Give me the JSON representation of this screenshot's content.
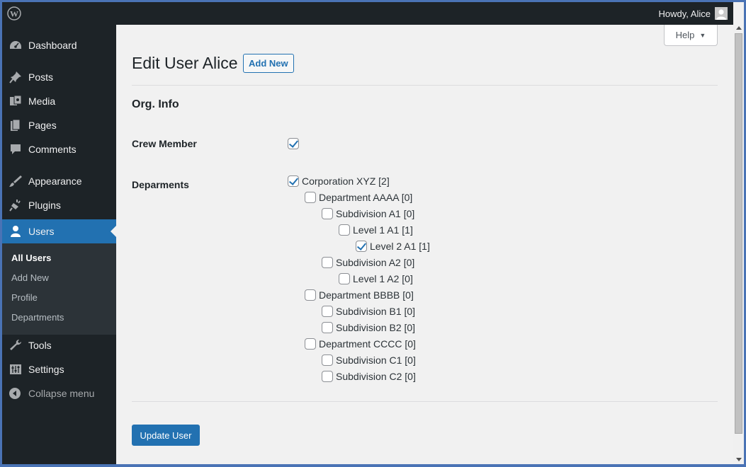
{
  "admin_bar": {
    "howdy": "Howdy, Alice"
  },
  "sidebar": {
    "items": [
      {
        "label": "Dashboard",
        "icon": "dashboard-icon"
      },
      {
        "label": "Posts",
        "icon": "pin-icon"
      },
      {
        "label": "Media",
        "icon": "media-icon"
      },
      {
        "label": "Pages",
        "icon": "pages-icon"
      },
      {
        "label": "Comments",
        "icon": "comment-icon"
      },
      {
        "label": "Appearance",
        "icon": "brush-icon"
      },
      {
        "label": "Plugins",
        "icon": "plug-icon"
      },
      {
        "label": "Users",
        "icon": "user-icon"
      },
      {
        "label": "Tools",
        "icon": "wrench-icon"
      },
      {
        "label": "Settings",
        "icon": "sliders-icon"
      },
      {
        "label": "Collapse menu",
        "icon": "collapse-arrow-icon"
      }
    ],
    "submenu": [
      "All Users",
      "Add New",
      "Profile",
      "Departments"
    ]
  },
  "help": {
    "label": "Help"
  },
  "header": {
    "title": "Edit User Alice",
    "add_new": "Add New"
  },
  "section": {
    "title": "Org. Info",
    "crew_label": "Crew Member",
    "crew_checked": true,
    "departments_label": "Deparments"
  },
  "departments": [
    {
      "label": "Corporation XYZ [2]",
      "level": 0,
      "checked": true
    },
    {
      "label": "Department AAAA [0]",
      "level": 1,
      "checked": false
    },
    {
      "label": "Subdivision A1 [0]",
      "level": 2,
      "checked": false
    },
    {
      "label": "Level 1 A1 [1]",
      "level": 3,
      "checked": false
    },
    {
      "label": "Level 2 A1 [1]",
      "level": 4,
      "checked": true
    },
    {
      "label": "Subdivision A2 [0]",
      "level": 2,
      "checked": false
    },
    {
      "label": "Level 1 A2 [0]",
      "level": 3,
      "checked": false
    },
    {
      "label": "Department BBBB [0]",
      "level": 1,
      "checked": false
    },
    {
      "label": "Subdivision B1 [0]",
      "level": 2,
      "checked": false
    },
    {
      "label": "Subdivision B2 [0]",
      "level": 2,
      "checked": false
    },
    {
      "label": "Department CCCC [0]",
      "level": 1,
      "checked": false
    },
    {
      "label": "Subdivision C1 [0]",
      "level": 2,
      "checked": false
    },
    {
      "label": "Subdivision C2 [0]",
      "level": 2,
      "checked": false
    }
  ],
  "footer": {
    "update": "Update User"
  },
  "colors": {
    "accent": "#2271b1",
    "sidebar": "#1d2327"
  }
}
